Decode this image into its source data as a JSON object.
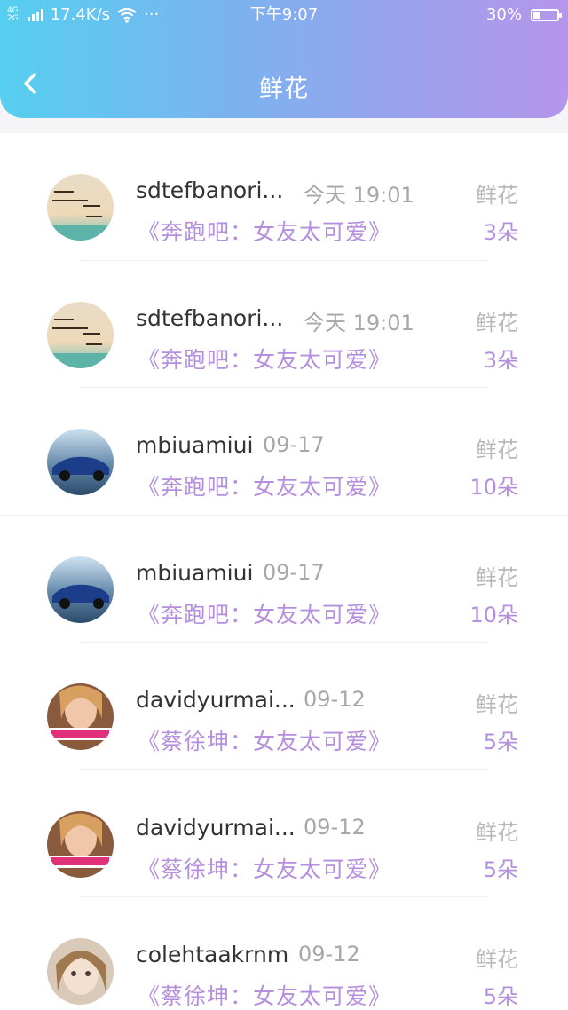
{
  "status_bar": {
    "network": [
      "4G",
      "2G"
    ],
    "speed": "17.4K/s",
    "more": "···",
    "time": "下午9:07",
    "battery": "30%",
    "battery_level": 0.3
  },
  "nav": {
    "title": "鲜花"
  },
  "records": [
    {
      "avatar": "avatar-calligraphy",
      "username": "sdtefbanori...",
      "time": "今天 19:01",
      "gift": "《奔跑吧：女友太可爱》",
      "label": "鲜花",
      "count": "3朵"
    },
    {
      "avatar": "avatar-calligraphy",
      "username": "sdtefbanori...",
      "time": "今天 19:01",
      "gift": "《奔跑吧：女友太可爱》",
      "label": "鲜花",
      "count": "3朵"
    },
    {
      "avatar": "avatar-car",
      "username": "mbiuamiui",
      "time": "09-17",
      "gift": "《奔跑吧：女友太可爱》",
      "label": "鲜花",
      "count": "10朵"
    },
    {
      "avatar": "avatar-car",
      "username": "mbiuamiui",
      "time": "09-17",
      "gift": "《奔跑吧：女友太可爱》",
      "label": "鲜花",
      "count": "10朵"
    },
    {
      "avatar": "avatar-girl",
      "username": "davidyurmai...",
      "time": "09-12",
      "gift": "《蔡徐坤：女友太可爱》",
      "label": "鲜花",
      "count": "5朵"
    },
    {
      "avatar": "avatar-girl",
      "username": "davidyurmai...",
      "time": "09-12",
      "gift": "《蔡徐坤：女友太可爱》",
      "label": "鲜花",
      "count": "5朵"
    },
    {
      "avatar": "avatar-doll",
      "username": "colehtaakrnm",
      "time": "09-12",
      "gift": "《蔡徐坤：女友太可爱》",
      "label": "鲜花",
      "count": "5朵"
    }
  ],
  "colors": {
    "accent": "#b58fdd",
    "header_start": "#56cff0",
    "header_end": "#b596ea"
  }
}
